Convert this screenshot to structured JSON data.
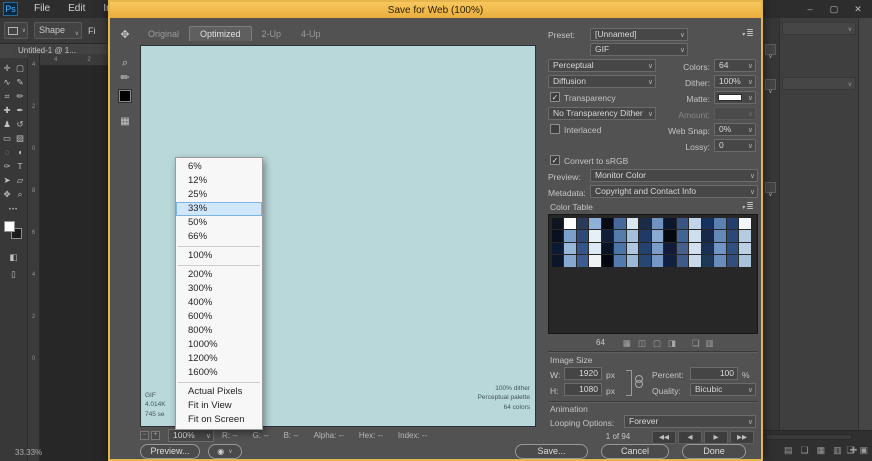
{
  "app": {
    "menubar": {
      "logo": "Ps",
      "menus": [
        "File",
        "Edit",
        "Image"
      ]
    },
    "window_controls": [
      {
        "name": "minimize",
        "glyph": "–"
      },
      {
        "name": "maximize",
        "glyph": "▢"
      },
      {
        "name": "close",
        "glyph": "✕"
      }
    ],
    "options_bar": {
      "shape_label": "Shape",
      "fill_label": "Fi"
    },
    "document_tab": "Untitled-1 @ 1...",
    "toolbar": {
      "tools": [
        {
          "name": "move-tool",
          "glyph": "✛"
        },
        {
          "name": "marquee-tool",
          "glyph": "▢"
        },
        {
          "name": "lasso-tool",
          "glyph": "∿"
        },
        {
          "name": "quick-selection-tool",
          "glyph": "✎"
        },
        {
          "name": "crop-tool",
          "glyph": "⌗"
        },
        {
          "name": "eyedropper-tool",
          "glyph": "✏"
        },
        {
          "name": "healing-brush-tool",
          "glyph": "✚"
        },
        {
          "name": "brush-tool",
          "glyph": "✒"
        },
        {
          "name": "clone-stamp-tool",
          "glyph": "♟"
        },
        {
          "name": "history-brush-tool",
          "glyph": "↺"
        },
        {
          "name": "eraser-tool",
          "glyph": "▭"
        },
        {
          "name": "gradient-tool",
          "glyph": "▨"
        },
        {
          "name": "blur-tool",
          "glyph": "◌"
        },
        {
          "name": "dodge-tool",
          "glyph": "◖"
        },
        {
          "name": "pen-tool",
          "glyph": "✑"
        },
        {
          "name": "type-tool",
          "glyph": "T"
        },
        {
          "name": "path-selection-tool",
          "glyph": "➤"
        },
        {
          "name": "shape-tool",
          "glyph": "▱"
        },
        {
          "name": "hand-tool",
          "glyph": "✥"
        },
        {
          "name": "zoom-tool",
          "glyph": "⌕"
        }
      ],
      "more_glyph": "•••",
      "extra_icons": [
        {
          "name": "quick-mask-icon",
          "glyph": "◧"
        },
        {
          "name": "screen-mode-icon",
          "glyph": "▯"
        }
      ],
      "foreground_color": "#ffffff",
      "background_color": "#1a1a1a"
    },
    "rulers": {
      "horizontal": [
        "4",
        "2"
      ],
      "vertical": [
        "4",
        "2",
        "0",
        "8",
        "6",
        "4",
        "2",
        "0"
      ]
    },
    "status_zoom": "33.33%",
    "dock": {
      "panel_icons": [
        {
          "name": "layers-panel-icon",
          "glyph": "▤"
        },
        {
          "name": "channels-panel-icon",
          "glyph": "❏"
        },
        {
          "name": "paths-panel-icon",
          "glyph": "▦"
        },
        {
          "name": "swatches-panel-icon",
          "glyph": "▥"
        },
        {
          "name": "add-panel-icon",
          "glyph": "✚"
        }
      ],
      "corner_icons": [
        {
          "name": "folder-icon",
          "glyph": "❏"
        },
        {
          "name": "library-icon",
          "glyph": "▣"
        }
      ]
    }
  },
  "dialog": {
    "title": "Save for Web (100%)",
    "tabs": [
      {
        "label": "Original",
        "active": false
      },
      {
        "label": "Optimized",
        "active": true
      },
      {
        "label": "2-Up",
        "active": false
      },
      {
        "label": "4-Up",
        "active": false
      }
    ],
    "side_tools": {
      "hand": "✥",
      "zoom": "⌕",
      "eyedropper": "✏",
      "eyedropper_color": "#000000",
      "slices": "▦"
    },
    "canvas_color": "#b9d8da",
    "preview_info": {
      "left": [
        "GIF",
        "4.014K",
        "745 se"
      ],
      "right": [
        "100% dither",
        "Perceptual palette",
        "64 colors"
      ]
    },
    "zoom_menu": {
      "items": [
        "6%",
        "12%",
        "25%",
        "33%",
        "50%",
        "66%",
        "100%",
        "200%",
        "300%",
        "400%",
        "600%",
        "800%",
        "1000%",
        "1200%",
        "1600%",
        "Actual Pixels",
        "Fit in View",
        "Fit on Screen"
      ],
      "selected": "33%",
      "separators_after": [
        "66%",
        "100%",
        "1600%"
      ]
    },
    "status": {
      "zoom_value": "100%",
      "mini_icons": [
        {
          "name": "zoom-out-icon",
          "glyph": "−"
        },
        {
          "name": "zoom-in-icon",
          "glyph": "+"
        }
      ],
      "readouts": [
        {
          "label": "R:",
          "value": "--"
        },
        {
          "label": "G:",
          "value": "--"
        },
        {
          "label": "B:",
          "value": "--"
        },
        {
          "label": "Alpha:",
          "value": "--"
        },
        {
          "label": "Hex:",
          "value": "--"
        },
        {
          "label": "Index:",
          "value": "--"
        }
      ]
    },
    "preview_button": "Preview...",
    "eye_glyph": "◉",
    "panel_menu_glyph": "≣",
    "settings": {
      "preset_label": "Preset:",
      "preset_value": "[Unnamed]",
      "format_value": "GIF",
      "palette_value": "Perceptual",
      "colors_label": "Colors:",
      "colors_value": "64",
      "dither_method_value": "Diffusion",
      "dither_label": "Dither:",
      "dither_value": "100%",
      "transparency_label": "Transparency",
      "transparency_checked": "✓",
      "matte_label": "Matte:",
      "matte_color": "#ffffff",
      "transparency_dither_value": "No Transparency Dither",
      "amount_label": "Amount:",
      "interlaced_label": "Interlaced",
      "interlaced_checked": "",
      "web_snap_label": "Web Snap:",
      "web_snap_value": "0%",
      "lossy_label": "Lossy:",
      "lossy_value": "0",
      "srgb_label": "Convert to sRGB",
      "srgb_checked": "✓",
      "preview_label": "Preview:",
      "preview_value": "Monitor Color",
      "metadata_label": "Metadata:",
      "metadata_value": "Copyright and Contact Info"
    },
    "color_table": {
      "title": "Color Table",
      "count": "64",
      "swatches": [
        "#10141e",
        "#ffffff",
        "#2a3a5a",
        "#8fb0d8",
        "#060a12",
        "#49689a",
        "#d9e6f2",
        "#1b2b48",
        "#6f92c0",
        "#0d1830",
        "#3a5584",
        "#c2d5e8",
        "#16325e",
        "#5c80b0",
        "#23406c",
        "#f2f6fa",
        "#0a1020",
        "#7ca0cc",
        "#2f4a78",
        "#e6eef6",
        "#111e3a",
        "#567cac",
        "#a5bfdc",
        "#1f3a66",
        "#8aaad2",
        "#050810",
        "#426494",
        "#cddeed",
        "#17284a",
        "#6688b8",
        "#2c4874",
        "#b5cbe2",
        "#0e1a34",
        "#98b6d8",
        "#36548a",
        "#dce8f2",
        "#081426",
        "#4d74a8",
        "#aec6e0",
        "#24426e",
        "#7e9cc8",
        "#121c38",
        "#48608c",
        "#d2e0ee",
        "#1a3054",
        "#7094c4",
        "#305080",
        "#bcd0e4",
        "#0c1628",
        "#84a8d0",
        "#3c5c90",
        "#eef3f8",
        "#040710",
        "#527aae",
        "#9cb8d8",
        "#284670",
        "#7698c4",
        "#0f2040",
        "#3e5a88",
        "#c8daea",
        "#1e3858",
        "#6a8cbc",
        "#344e7c",
        "#a8c2dc"
      ],
      "footer_icons": [
        {
          "name": "snap-to-web-icon",
          "glyph": "▦"
        },
        {
          "name": "lock-color-icon",
          "glyph": "◫"
        },
        {
          "name": "shift-color-icon",
          "glyph": "▢"
        },
        {
          "name": "map-transparency-icon",
          "glyph": "◨"
        }
      ],
      "action_icons": [
        {
          "name": "new-color-icon",
          "glyph": "❏"
        },
        {
          "name": "delete-color-icon",
          "glyph": "▥"
        }
      ]
    },
    "image_size": {
      "title": "Image Size",
      "w_label": "W:",
      "w_value": "1920",
      "w_unit": "px",
      "h_label": "H:",
      "h_value": "1080",
      "h_unit": "px",
      "percent_label": "Percent:",
      "percent_value": "100",
      "percent_unit": "%",
      "quality_label": "Quality:",
      "quality_value": "Bicubic"
    },
    "animation": {
      "title": "Animation",
      "looping_label": "Looping Options:",
      "looping_value": "Forever",
      "frame_counter": "1 of 94",
      "playback": [
        {
          "name": "first-frame-button",
          "glyph": "◀◀"
        },
        {
          "name": "previous-frame-button",
          "glyph": "◀"
        },
        {
          "name": "play-button",
          "glyph": "▶"
        },
        {
          "name": "next-frame-button",
          "glyph": "▶▶"
        }
      ]
    },
    "footer_buttons": [
      {
        "name": "save-button",
        "label": "Save..."
      },
      {
        "name": "cancel-button",
        "label": "Cancel"
      },
      {
        "name": "done-button",
        "label": "Done"
      }
    ]
  }
}
